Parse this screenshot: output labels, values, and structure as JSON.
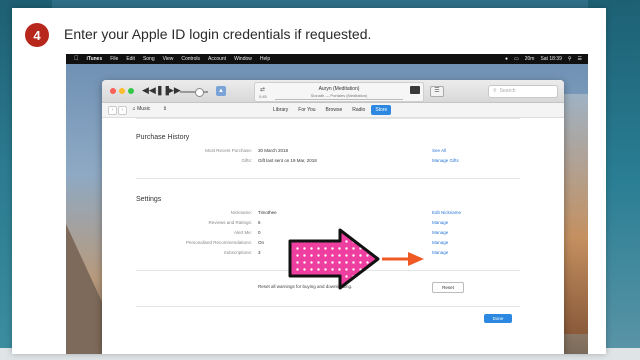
{
  "step": {
    "number": "4",
    "instruction": "Enter your Apple ID login credentials if requested."
  },
  "menubar": {
    "items": [
      "iTunes",
      "File",
      "Edit",
      "Song",
      "View",
      "Controls",
      "Account",
      "Window",
      "Help"
    ],
    "battery": "20m",
    "clock": "Sat 18:39"
  },
  "player": {
    "track_title": "Auryn (Meditation)",
    "track_artist": "Slonath — Portales (Meditation)",
    "elapsed": "0:45"
  },
  "search": {
    "placeholder": "Search"
  },
  "nav": {
    "media_label": "Music",
    "tabs": [
      "Library",
      "For You",
      "Browse",
      "Radio",
      "Store"
    ],
    "active_tab": "Store"
  },
  "purchase_history": {
    "heading": "Purchase History",
    "rows": [
      {
        "label": "Most Recent Purchase:",
        "value": "30 March 2018",
        "action": "See All"
      },
      {
        "label": "Gifts:",
        "value": "Gift last sent on 19 Mar, 2018",
        "action": "Manage Gifts"
      }
    ]
  },
  "settings": {
    "heading": "Settings",
    "rows": [
      {
        "label": "Nickname:",
        "value": "Timothee",
        "action": "Edit Nickname"
      },
      {
        "label": "Reviews and Ratings:",
        "value": "6",
        "action": "Manage"
      },
      {
        "label": "Alert Me:",
        "value": "0",
        "action": "Manage"
      },
      {
        "label": "Personalised Recommendations:",
        "value": "On",
        "action": "Manage"
      },
      {
        "label": "Subscriptions:",
        "value": "3",
        "action": "Manage"
      }
    ]
  },
  "reset": {
    "text": "Reset all warnings for buying and downloading.",
    "button": "Reset"
  },
  "done_button": "Done",
  "colors": {
    "badge": "#b8271c",
    "accent": "#2c88e0",
    "link": "#2c78d8",
    "arrow_pink": "#ee3fa0",
    "arrow_orange": "#ef5a24"
  }
}
